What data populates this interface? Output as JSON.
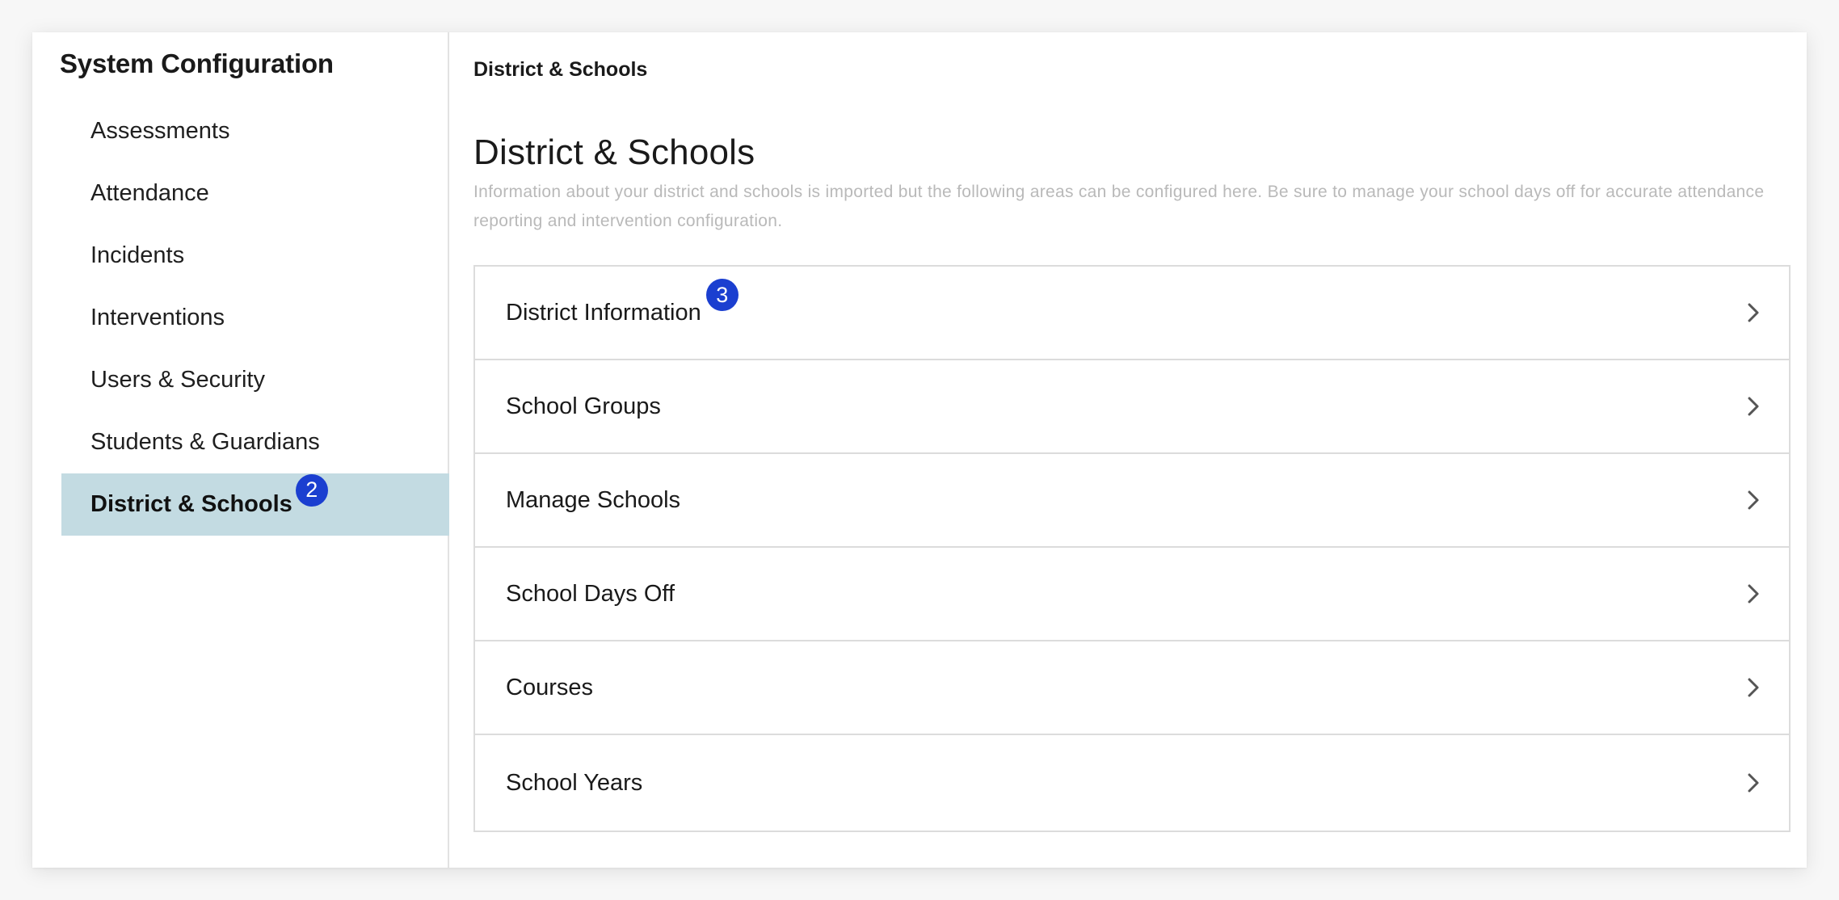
{
  "sidebar": {
    "title": "System Configuration",
    "items": [
      {
        "label": "Assessments"
      },
      {
        "label": "Attendance"
      },
      {
        "label": "Incidents"
      },
      {
        "label": "Interventions"
      },
      {
        "label": "Users & Security"
      },
      {
        "label": "Students & Guardians"
      },
      {
        "label": "District & Schools",
        "active": true,
        "badge": "2"
      }
    ]
  },
  "main": {
    "breadcrumb": "District & Schools",
    "title": "District & Schools",
    "description": "Information about your district and schools is imported but the following areas can be configured here. Be sure to manage your school days off for accurate attendance reporting and intervention configuration.",
    "rows": [
      {
        "label": "District Information",
        "badge": "3"
      },
      {
        "label": "School Groups"
      },
      {
        "label": "Manage Schools"
      },
      {
        "label": "School Days Off"
      },
      {
        "label": "Courses"
      },
      {
        "label": "School Years"
      }
    ]
  },
  "icons": {
    "row_chevron": "chevron-right-icon"
  },
  "colors": {
    "active_bg": "#c3dbe2",
    "badge_bg": "#1b3fd0",
    "muted_text": "#b9b9b9"
  }
}
